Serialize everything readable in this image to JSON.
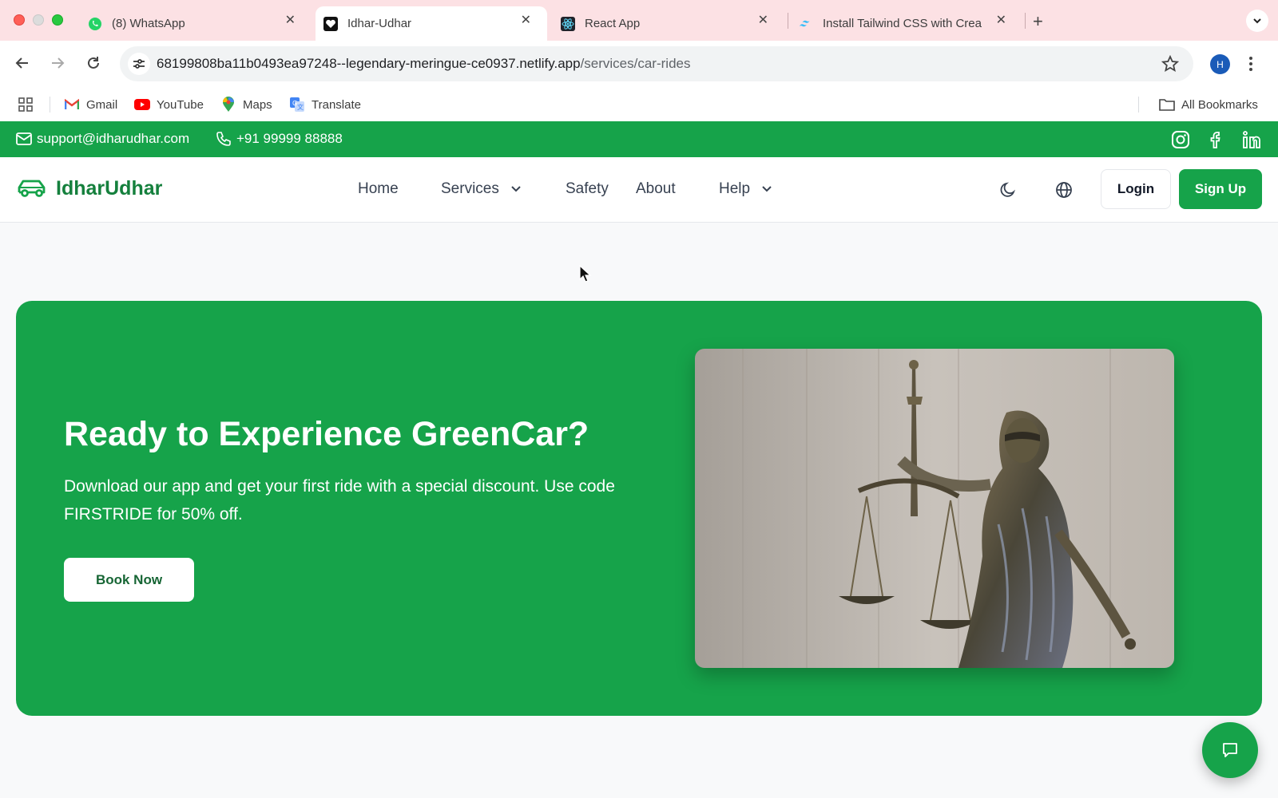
{
  "browser": {
    "tabs": [
      {
        "title": "(8) WhatsApp",
        "icon": "whatsapp-icon",
        "active": false
      },
      {
        "title": "Idhar-Udhar",
        "icon": "heart-icon",
        "active": true
      },
      {
        "title": "React App",
        "icon": "react-icon",
        "active": false
      },
      {
        "title": "Install Tailwind CSS with Crea",
        "icon": "tailwind-icon",
        "active": false
      }
    ],
    "url_host": "68199808ba11b0493ea97248--legendary-meringue-ce0937.netlify.app",
    "url_path": "/services/car-rides",
    "profile_initial": "H",
    "bookmarks": [
      {
        "label": "Gmail",
        "icon": "gmail-icon"
      },
      {
        "label": "YouTube",
        "icon": "youtube-icon"
      },
      {
        "label": "Maps",
        "icon": "maps-icon"
      },
      {
        "label": "Translate",
        "icon": "translate-icon"
      }
    ],
    "all_bookmarks": "All Bookmarks"
  },
  "topbar": {
    "email": "support@idharudhar.com",
    "phone": "+91 99999 88888",
    "socials": [
      "instagram-icon",
      "facebook-icon",
      "linkedin-icon"
    ]
  },
  "header": {
    "logo": "IdharUdhar",
    "nav": {
      "home": "Home",
      "services": "Services",
      "safety": "Safety",
      "about": "About",
      "help": "Help"
    },
    "login": "Login",
    "signup": "Sign Up"
  },
  "hero": {
    "title": "Ready to Experience GreenCar?",
    "text": "Download our app and get your first ride with a special discount. Use code FIRSTRIDE for 50% off.",
    "cta": "Book Now",
    "image": "lady-justice-statue-photo"
  },
  "colors": {
    "brand_green": "#16a34a",
    "brand_green_dark": "#15803d",
    "tabbar": "#fce1e4"
  }
}
